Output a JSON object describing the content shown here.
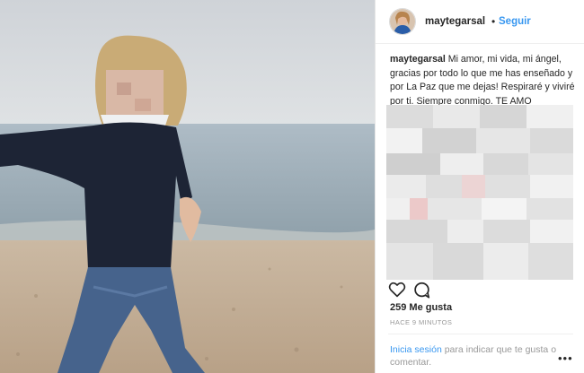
{
  "post": {
    "username": "maytegarsal",
    "dot": "•",
    "follow_label": "Seguir",
    "caption_user": "maytegarsal",
    "caption_text": "Mi amor, mi vida, mi ángel, gracias por todo lo que me has enseñado y por La Paz que me dejas! Respiraré y viviré por ti. Siempre conmigo. TE AMO",
    "likes": "259 Me gusta",
    "time": "HACE 9 MINUTOS"
  },
  "footer": {
    "login_link": "Inicia sesión",
    "login_text": " para indicar que te gusta o comentar.",
    "more": "•••"
  },
  "icons": {
    "like": "heart-icon",
    "comment": "comment-icon",
    "more": "more-options-icon"
  },
  "colors": {
    "link": "#3897f0",
    "text": "#262626",
    "muted": "#999999"
  }
}
